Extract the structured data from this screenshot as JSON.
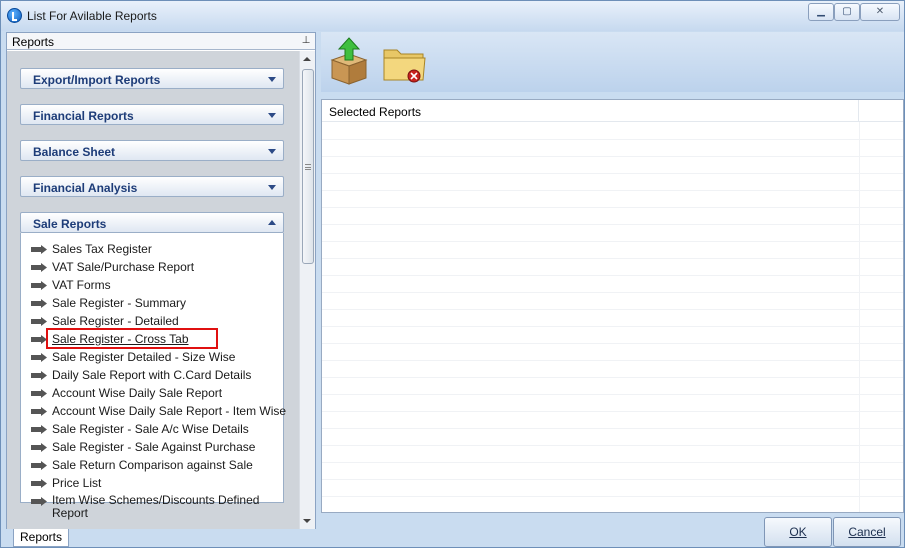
{
  "window": {
    "title": "List For Avilable Reports",
    "min_symbol": "▁",
    "max_symbol": "▢",
    "close_symbol": "✕"
  },
  "left_panel": {
    "header_label": "Reports",
    "pin_icon": "pin-icon",
    "sections": [
      {
        "label": "Export/Import Reports",
        "expanded": false
      },
      {
        "label": "Financial Reports",
        "expanded": false
      },
      {
        "label": "Balance Sheet",
        "expanded": false
      },
      {
        "label": "Financial Analysis",
        "expanded": false
      },
      {
        "label": "Sale Reports",
        "expanded": true
      }
    ],
    "sale_reports_items": [
      "Sales Tax Register",
      "VAT Sale/Purchase Report",
      "VAT Forms",
      "Sale Register - Summary",
      "Sale Register - Detailed",
      "Sale Register - Cross Tab",
      "Sale Register Detailed - Size Wise",
      "Daily Sale Report with C.Card Details",
      "Account Wise Daily Sale Report",
      "Account Wise Daily Sale Report - Item Wise",
      "Sale Register - Sale A/c Wise Details",
      "Sale Register - Sale Against Purchase",
      "Sale Return Comparison against Sale",
      "Price List",
      "Item Wise Schemes/Discounts Defined Report"
    ],
    "highlighted_item": "Sale Register - Cross Tab",
    "bottom_tab_label": "Reports"
  },
  "toolbar": {
    "buttons": [
      {
        "icon": "box-upload-icon"
      },
      {
        "icon": "folder-close-icon"
      }
    ]
  },
  "grid": {
    "column_header": "Selected Reports"
  },
  "buttons": {
    "ok_label": "OK",
    "cancel_label": "Cancel"
  },
  "colors": {
    "section_text": "#1d3c78",
    "highlight_border": "#e01010",
    "chrome_blue": "#c9dcf0"
  }
}
